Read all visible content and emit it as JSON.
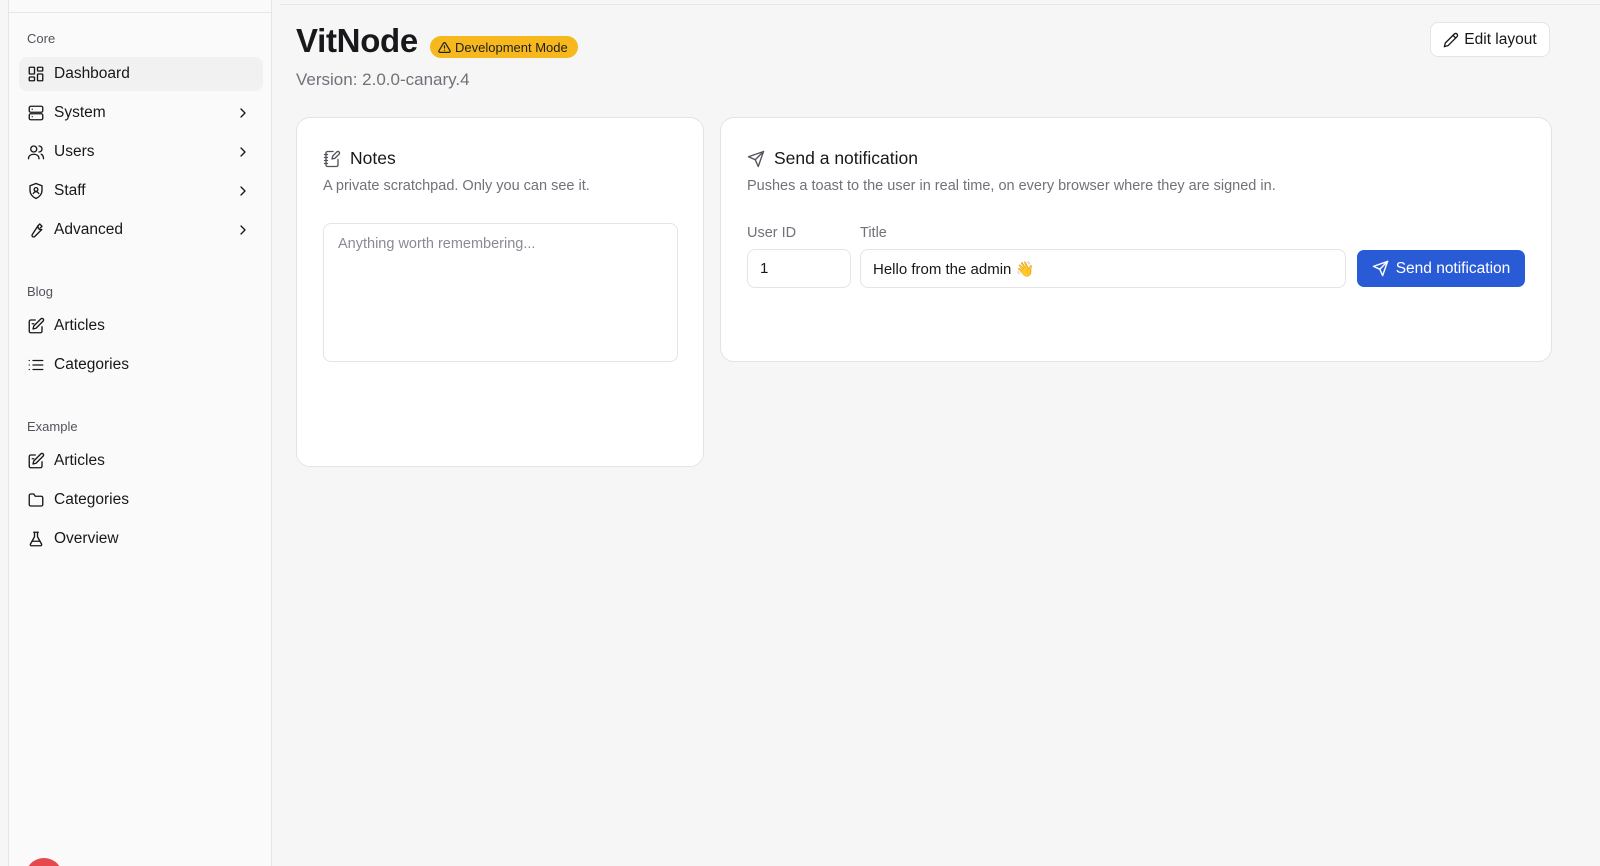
{
  "sidebar": {
    "groups": [
      {
        "label": "Core",
        "items": [
          {
            "label": "Dashboard",
            "icon": "dashboard-icon",
            "active": true
          },
          {
            "label": "System",
            "icon": "server-icon",
            "has_children": true
          },
          {
            "label": "Users",
            "icon": "users-icon",
            "has_children": true
          },
          {
            "label": "Staff",
            "icon": "shield-icon",
            "has_children": true
          },
          {
            "label": "Advanced",
            "icon": "wrench-icon",
            "has_children": true
          }
        ]
      },
      {
        "label": "Blog",
        "items": [
          {
            "label": "Articles",
            "icon": "edit-square-icon"
          },
          {
            "label": "Categories",
            "icon": "list-icon"
          }
        ]
      },
      {
        "label": "Example",
        "items": [
          {
            "label": "Articles",
            "icon": "edit-square-icon"
          },
          {
            "label": "Categories",
            "icon": "folder-icon"
          },
          {
            "label": "Overview",
            "icon": "flask-icon"
          }
        ]
      }
    ]
  },
  "header": {
    "title": "VitNode",
    "badge": "Development Mode",
    "version": "Version: 2.0.0-canary.4",
    "edit_layout_label": "Edit layout"
  },
  "notes_card": {
    "title": "Notes",
    "description": "A private scratchpad. Only you can see it.",
    "placeholder": "Anything worth remembering..."
  },
  "notify_card": {
    "title": "Send a notification",
    "description": "Pushes a toast to the user in real time, on every browser where they are signed in.",
    "user_id_label": "User ID",
    "user_id_value": "1",
    "title_label": "Title",
    "title_value": "Hello from the admin 👋",
    "send_label": "Send notification"
  },
  "colors": {
    "accent": "#2a5bd7",
    "badge": "#f6b81c"
  }
}
